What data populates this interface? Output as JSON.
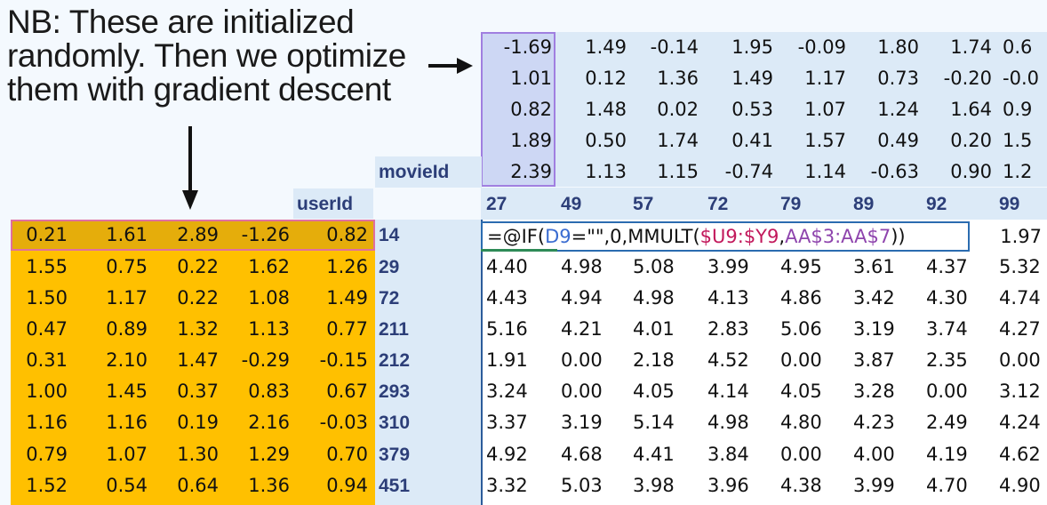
{
  "annotation": {
    "lines": [
      "NB: These are initialized",
      "randomly. Then we optimize",
      "them with gradient descent"
    ]
  },
  "labels": {
    "movieId": "movieId",
    "userId": "userId"
  },
  "movie_latents": [
    [
      "-1.69",
      "1.49",
      "-0.14",
      "1.95",
      "-0.09",
      "1.80",
      "1.74",
      "0.6"
    ],
    [
      "1.01",
      "0.12",
      "1.36",
      "1.49",
      "1.17",
      "0.73",
      "-0.20",
      "-0.0"
    ],
    [
      "0.82",
      "1.48",
      "0.02",
      "0.53",
      "1.07",
      "1.24",
      "1.64",
      "0.9"
    ],
    [
      "1.89",
      "0.50",
      "1.74",
      "0.41",
      "1.57",
      "0.49",
      "0.20",
      "1.5"
    ],
    [
      "2.39",
      "1.13",
      "1.15",
      "-0.74",
      "1.14",
      "-0.63",
      "0.90",
      "1.2"
    ]
  ],
  "movie_ids": [
    "27",
    "49",
    "57",
    "72",
    "79",
    "89",
    "92",
    "99"
  ],
  "user_ids": [
    "14",
    "29",
    "72",
    "211",
    "212",
    "293",
    "310",
    "379",
    "451"
  ],
  "user_latents": [
    [
      "0.21",
      "1.61",
      "2.89",
      "-1.26",
      "0.82"
    ],
    [
      "1.55",
      "0.75",
      "0.22",
      "1.62",
      "1.26"
    ],
    [
      "1.50",
      "1.17",
      "0.22",
      "1.08",
      "1.49"
    ],
    [
      "0.47",
      "0.89",
      "1.32",
      "1.13",
      "0.77"
    ],
    [
      "0.31",
      "2.10",
      "1.47",
      "-0.29",
      "-0.15"
    ],
    [
      "1.00",
      "1.45",
      "0.37",
      "0.83",
      "0.67"
    ],
    [
      "1.16",
      "1.16",
      "0.19",
      "2.16",
      "-0.03"
    ],
    [
      "0.79",
      "1.07",
      "1.30",
      "1.29",
      "0.70"
    ],
    [
      "1.52",
      "0.54",
      "0.64",
      "1.36",
      "0.94"
    ]
  ],
  "formula": {
    "p1": "=@IF(",
    "p2": "D9",
    "p3": "=\"\",0,MMULT(",
    "p4": "$U9:$Y9",
    "p5": ",",
    "p6": "AA$3:AA$7",
    "p7": "))",
    "after": "1.97"
  },
  "predictions": [
    [
      "4.40",
      "4.98",
      "5.08",
      "3.99",
      "4.95",
      "3.61",
      "4.37",
      "5.32"
    ],
    [
      "4.43",
      "4.94",
      "4.98",
      "4.13",
      "4.86",
      "3.42",
      "4.30",
      "4.74"
    ],
    [
      "5.16",
      "4.21",
      "4.01",
      "2.83",
      "5.06",
      "3.19",
      "3.74",
      "4.27"
    ],
    [
      "1.91",
      "0.00",
      "2.18",
      "4.52",
      "0.00",
      "3.87",
      "2.35",
      "0.00"
    ],
    [
      "3.24",
      "0.00",
      "4.05",
      "4.14",
      "4.05",
      "3.28",
      "0.00",
      "3.12"
    ],
    [
      "3.37",
      "3.19",
      "5.14",
      "4.98",
      "4.80",
      "4.23",
      "2.49",
      "4.24"
    ],
    [
      "4.92",
      "4.68",
      "4.41",
      "3.84",
      "0.00",
      "4.00",
      "4.19",
      "4.62"
    ],
    [
      "3.32",
      "5.03",
      "3.98",
      "3.96",
      "4.38",
      "3.99",
      "4.70",
      "4.90"
    ]
  ],
  "colors": {
    "user_block": "#ffc000",
    "movie_block": "#dceaf7",
    "formula_border": "#2b6cb0"
  }
}
